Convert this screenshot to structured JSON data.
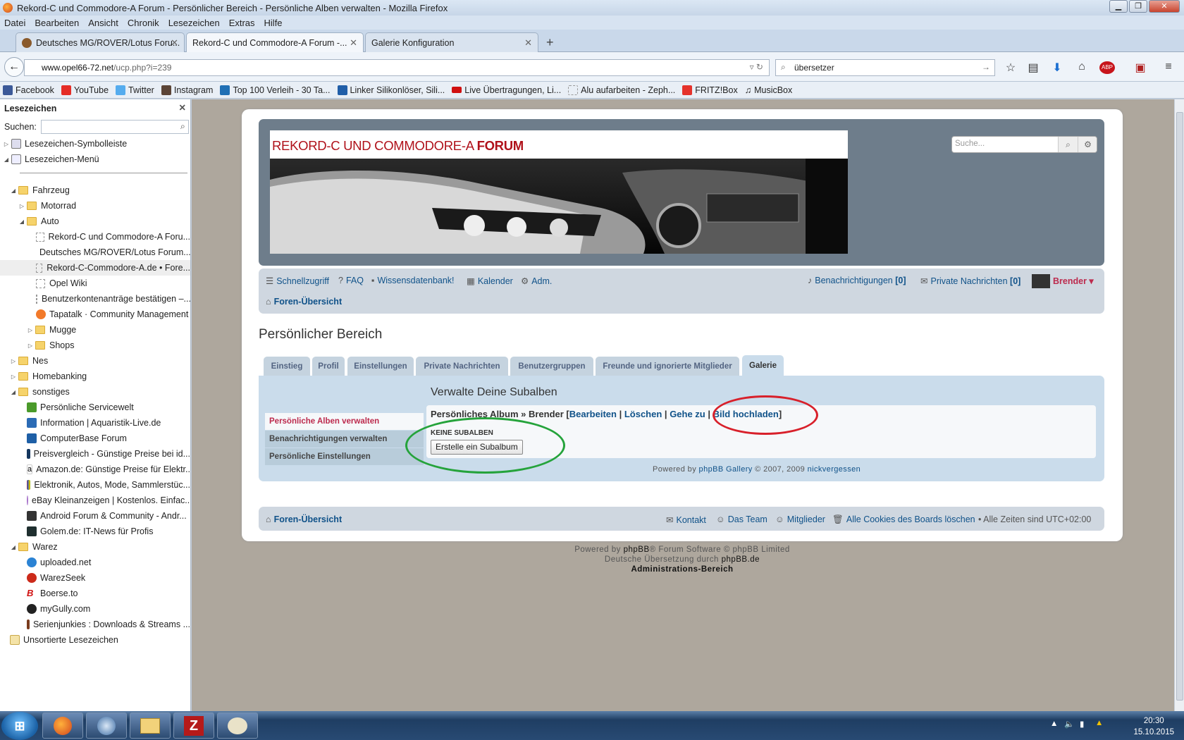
{
  "window": {
    "title": "Rekord-C und Commodore-A Forum - Persönlicher Bereich - Persönliche Alben verwalten - Mozilla Firefox"
  },
  "menu": [
    "Datei",
    "Bearbeiten",
    "Ansicht",
    "Chronik",
    "Lesezeichen",
    "Extras",
    "Hilfe"
  ],
  "tabs": [
    {
      "label": "Deutsches MG/ROVER/Lotus Foru...",
      "active": false
    },
    {
      "label": "Rekord-C und Commodore-A Forum -...",
      "active": true
    },
    {
      "label": "Galerie Konfiguration",
      "active": false
    }
  ],
  "nav": {
    "url_host": "www.opel66-72.net",
    "url_path": "/ucp.php?i=239",
    "search_value": "übersetzer"
  },
  "bookmarks_toolbar": [
    "Facebook",
    "YouTube",
    "Twitter",
    "Instagram",
    "Top 100 Verleih - 30 Ta...",
    "Linker Silikonlöser, Sili...",
    "Live Übertragungen, Li...",
    "Alu aufarbeiten - Zeph...",
    "FRITZ!Box",
    "MusicBox"
  ],
  "sidebar": {
    "title": "Lesezeichen",
    "search_label": "Suchen:",
    "items": [
      {
        "label": "Lesezeichen-Symbolleiste"
      },
      {
        "label": "Lesezeichen-Menü"
      },
      {
        "label": "Fahrzeug"
      },
      {
        "label": "Motorrad"
      },
      {
        "label": "Auto"
      },
      {
        "label": "Rekord-C und Commodore-A Foru..."
      },
      {
        "label": "Deutsches MG/ROVER/Lotus Forum..."
      },
      {
        "label": "Rekord-C-Commodore-A.de • Fore..."
      },
      {
        "label": "Opel Wiki"
      },
      {
        "label": "Benutzerkontenanträge bestätigen –..."
      },
      {
        "label": "Tapatalk · Community Management"
      },
      {
        "label": "Mugge"
      },
      {
        "label": "Shops"
      },
      {
        "label": "Nes"
      },
      {
        "label": "Homebanking"
      },
      {
        "label": "sonstiges"
      },
      {
        "label": "Persönliche Servicewelt"
      },
      {
        "label": "Information | Aquaristik-Live.de"
      },
      {
        "label": "ComputerBase Forum"
      },
      {
        "label": "Preisvergleich - Günstige Preise bei id..."
      },
      {
        "label": "Amazon.de: Günstige Preise für Elektr..."
      },
      {
        "label": "Elektronik, Autos, Mode, Sammlerstüc..."
      },
      {
        "label": "eBay Kleinanzeigen | Kostenlos. Einfac..."
      },
      {
        "label": "Android Forum & Community - Andr..."
      },
      {
        "label": "Golem.de: IT-News für Profis"
      },
      {
        "label": "Warez"
      },
      {
        "label": "uploaded.net"
      },
      {
        "label": "WarezSeek"
      },
      {
        "label": "Boerse.to"
      },
      {
        "label": "myGully.com"
      },
      {
        "label": "Serienjunkies : Downloads & Streams ..."
      },
      {
        "label": "Unsortierte Lesezeichen"
      }
    ]
  },
  "forum": {
    "logo_normal": "REKORD-C UND COMMODORE-A ",
    "logo_bold": "FORUM",
    "search_placeholder": "Suche...",
    "navbar": {
      "quick": "Schnellzugriff",
      "faq": "FAQ",
      "kb": "Wissensdatenbank!",
      "calendar": "Kalender",
      "adm": "Adm.",
      "notifications": "Benachrichtigungen",
      "notif_count": "[0]",
      "pm": "Private Nachrichten",
      "pm_count": "[0]",
      "user": "Brender ▾",
      "breadcrumb": "Foren-Übersicht"
    },
    "page_title": "Persönlicher Bereich",
    "tabs": [
      "Einstieg",
      "Profil",
      "Einstellungen",
      "Private Nachrichten",
      "Benutzergruppen",
      "Freunde und ignorierte Mitglieder",
      "Galerie"
    ],
    "menu": [
      "Persönliche Alben verwalten",
      "Benachrichtigungen verwalten",
      "Persönliche Einstellungen"
    ],
    "panel": {
      "title": "Verwalte Deine Subalben",
      "album": "Persönliches Album » Brender",
      "edit": "Bearbeiten",
      "delete": "Löschen",
      "goto": "Gehe zu",
      "upload": "Bild hochladen",
      "no_sub": "KEINE SUBALBEN",
      "create_btn": "Erstelle ein Subalbum",
      "powered_prefix": "Powered by ",
      "powered_link": "phpBB Gallery",
      "powered_suffix": " © 2007, 2009 ",
      "powered_author": "nickvergessen"
    },
    "footer_nav": {
      "home": "Foren-Übersicht",
      "contact": "Kontakt",
      "team": "Das Team",
      "members": "Mitglieder",
      "cookies": "Alle Cookies des Boards löschen",
      "timezone": "• Alle Zeiten sind UTC+02:00"
    },
    "footer": {
      "line1_prefix": "Powered by ",
      "line1_link": "phpBB",
      "line1_suffix": "® Forum Software © phpBB Limited",
      "line2_prefix": "Deutsche Übersetzung durch ",
      "line2_link": "phpBB.de",
      "line3": "Administrations-Bereich"
    }
  },
  "annotation_colors": {
    "red": "#d8202a",
    "green": "#25a33b"
  },
  "taskbar": {
    "time": "20:30",
    "date": "15.10.2015"
  }
}
